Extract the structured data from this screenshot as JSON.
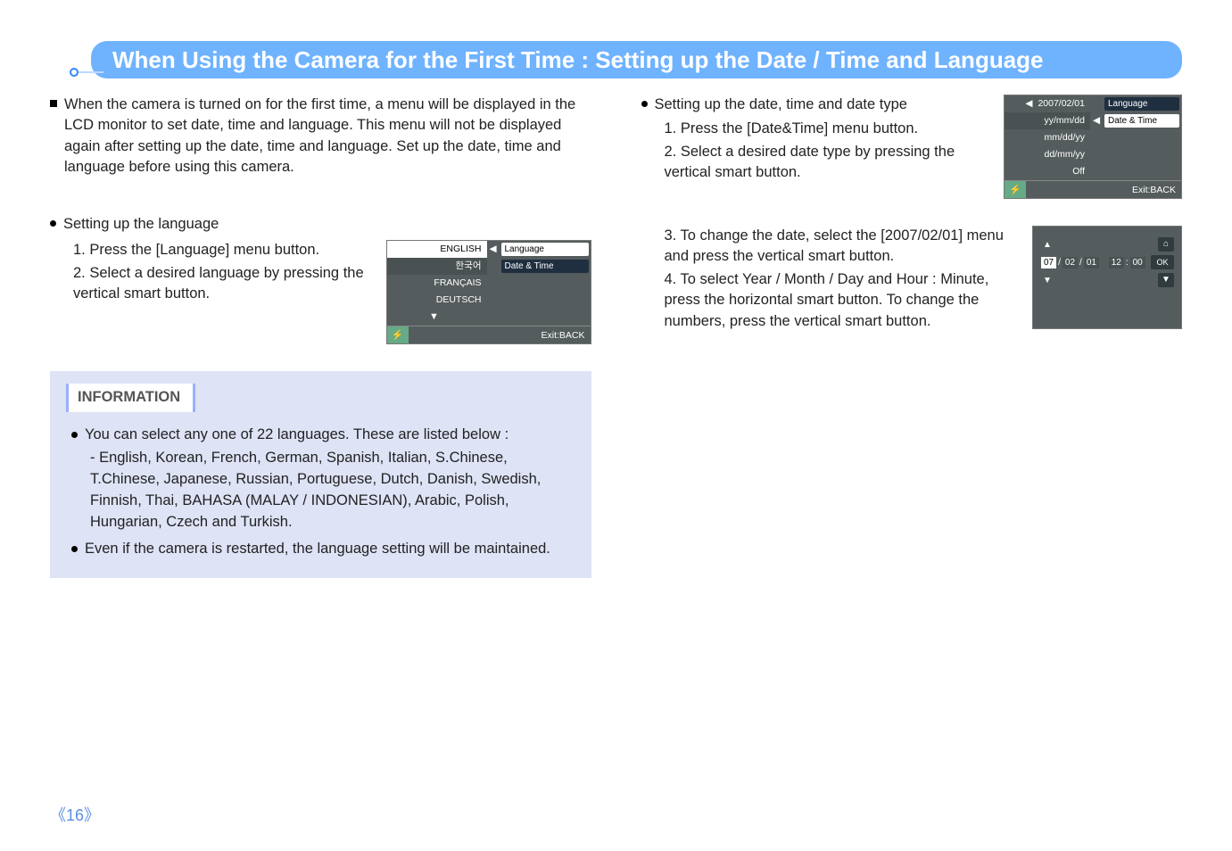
{
  "title": "When Using the Camera for the First Time : Setting up the Date / Time and Language",
  "page_number": "《16》",
  "left": {
    "intro": "When the camera is turned on for the first time, a menu will be displayed in the LCD monitor to set date, time and language. This menu will not be displayed again after setting up the date, time and language. Set up the date, time and language before using this camera.",
    "lang_heading": "Setting up the language",
    "lang_step1": "1. Press the [Language] menu button.",
    "lang_step2": "2. Select a desired language by pressing the vertical smart button."
  },
  "lcd_lang": {
    "opt1": "ENGLISH",
    "opt2": "한국어",
    "opt3": "FRANÇAIS",
    "opt4": "DEUTSCH",
    "tab1": "Language",
    "tab2": "Date & Time",
    "exit": "Exit:BACK",
    "arrow": "◀",
    "down": "▼"
  },
  "right": {
    "date_heading": "Setting up the date, time and date type",
    "date_step1": "1. Press the [Date&Time] menu button.",
    "date_step2": "2. Select a desired date type by pressing the vertical smart button.",
    "date_step3": "3. To change the date, select the [2007/02/01] menu and press the vertical smart button.",
    "date_step4": "4. To select Year / Month / Day and Hour : Minute, press the horizontal smart button. To change the numbers, press the vertical smart button."
  },
  "lcd_date": {
    "top": "2007/02/01",
    "opt1": "yy/mm/dd",
    "opt2": "mm/dd/yy",
    "opt3": "dd/mm/yy",
    "opt4": "Off",
    "tab1": "Language",
    "tab2": "Date & Time",
    "exit": "Exit:BACK",
    "arrow": "◀"
  },
  "lcd_set": {
    "yy": "07",
    "mm": "02",
    "dd": "01",
    "hh": "12",
    "min": "00",
    "ok": "OK",
    "up": "▲",
    "down": "▼",
    "home": "⌂",
    "downicon": "▼"
  },
  "info": {
    "title": "INFORMATION",
    "item1": "You can select any one of 22 languages. These are listed below :",
    "item1_detail": "- English, Korean, French, German, Spanish, Italian, S.Chinese, T.Chinese, Japanese, Russian, Portuguese, Dutch, Danish, Swedish, Finnish, Thai, BAHASA (MALAY / INDONESIAN), Arabic, Polish, Hungarian, Czech and Turkish.",
    "item2": "Even if the camera is restarted, the language setting will be maintained."
  }
}
